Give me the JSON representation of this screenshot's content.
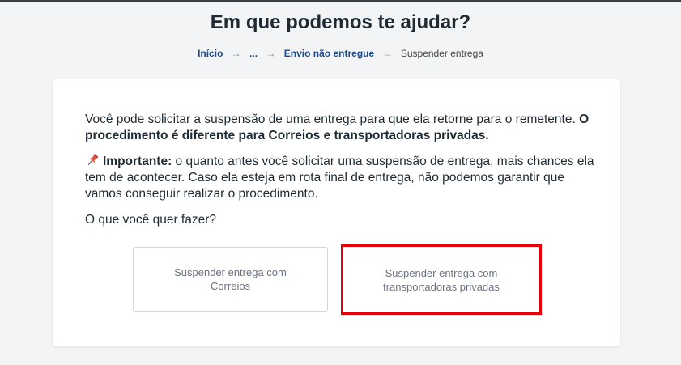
{
  "header": {
    "title": "Em que podemos te ajudar?"
  },
  "breadcrumb": {
    "items": [
      "Início",
      "...",
      "Envio não entregue",
      "Suspender entrega"
    ],
    "separator": "→"
  },
  "content": {
    "p1_normal": "Você pode solicitar a suspensão de uma entrega para que ela retorne para o remetente. ",
    "p1_bold": "O procedimento é diferente para Correios e transportadoras privadas.",
    "p2_icon": "pushpin-icon",
    "p2_bold": "Importante:",
    "p2_normal": " o quanto antes você solicitar uma suspensão de entrega, mais chances ela tem de acontecer. Caso ela esteja em rota final de entrega, não podemos garantir que vamos conseguir realizar o procedimento.",
    "question": "O que você quer fazer?"
  },
  "options": [
    {
      "label": "Suspender entrega com Correios"
    },
    {
      "label": "Suspender entrega com transportadoras privadas",
      "highlighted": true
    }
  ],
  "colors": {
    "highlight": "#e8000b",
    "link": "#1b4b8a"
  }
}
